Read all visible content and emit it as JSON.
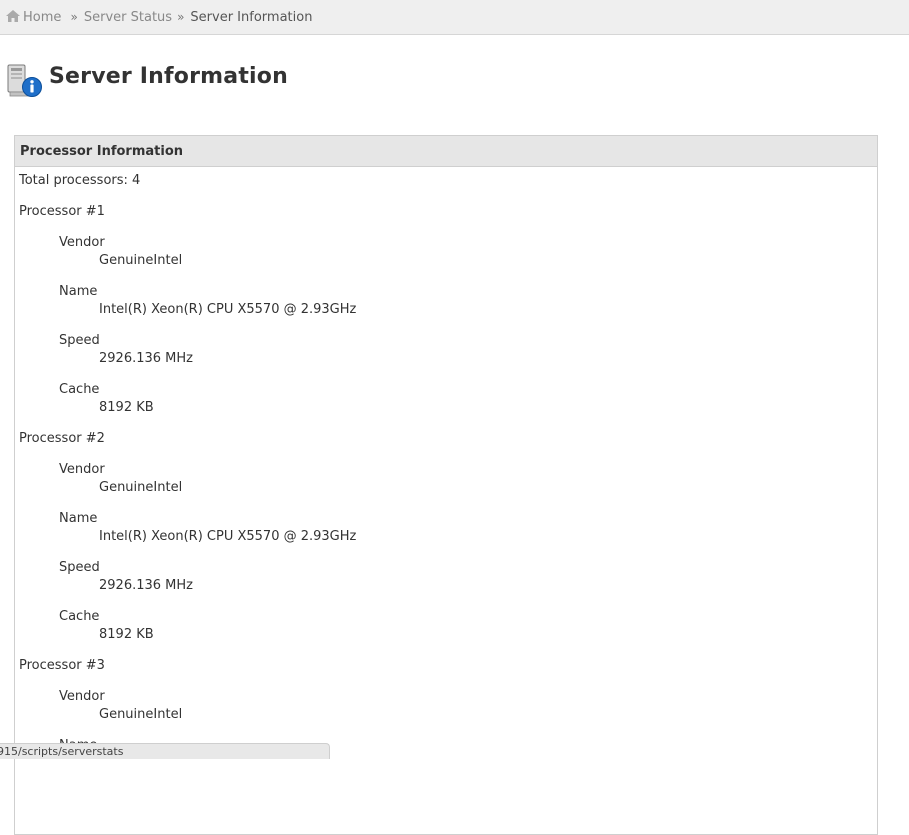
{
  "breadcrumb": {
    "items": [
      "Home",
      "Server Status",
      "Server Information"
    ],
    "separator": "»"
  },
  "page": {
    "title": "Server Information",
    "icon": "server-info-icon"
  },
  "processor_panel": {
    "title": "Processor Information",
    "total_label": "Total processors: 4",
    "processors": [
      {
        "heading": "Processor #1",
        "vendor_label": "Vendor",
        "vendor": "GenuineIntel",
        "name_label": "Name",
        "name": "Intel(R) Xeon(R) CPU X5570 @ 2.93GHz",
        "speed_label": "Speed",
        "speed": "2926.136 MHz",
        "cache_label": "Cache",
        "cache": "8192 KB"
      },
      {
        "heading": "Processor #2",
        "vendor_label": "Vendor",
        "vendor": "GenuineIntel",
        "name_label": "Name",
        "name": "Intel(R) Xeon(R) CPU X5570 @ 2.93GHz",
        "speed_label": "Speed",
        "speed": "2926.136 MHz",
        "cache_label": "Cache",
        "cache": "8192 KB"
      },
      {
        "heading": "Processor #3",
        "vendor_label": "Vendor",
        "vendor": "GenuineIntel",
        "name_label": "Name"
      }
    ]
  },
  "status_bar": {
    "url": "915/scripts/serverstats"
  },
  "colors": {
    "breadcrumb_bg": "#efefef",
    "panel_header_bg": "#e6e6e6",
    "info_icon_blue": "#1f6fc9"
  }
}
